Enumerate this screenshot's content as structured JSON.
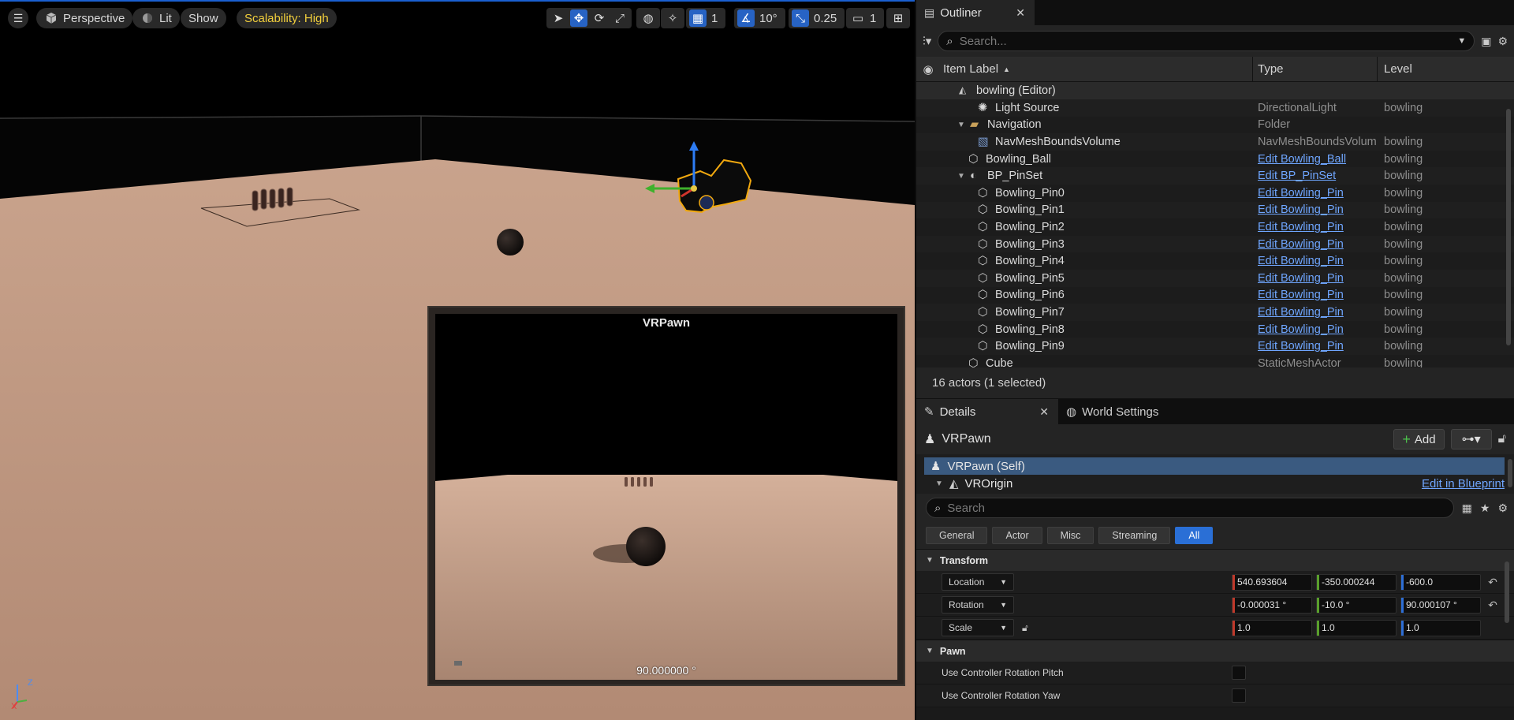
{
  "viewport": {
    "perspective_label": "Perspective",
    "lit_label": "Lit",
    "show_label": "Show",
    "scalability_label": "Scalability: High",
    "grid_value": "1",
    "angle_value": "10°",
    "scale_value": "0.25",
    "camera_value": "1",
    "pip": {
      "title": "VRPawn",
      "angle_readout": "90.000000 °"
    },
    "axis": {
      "x": "X",
      "z": "Z"
    }
  },
  "outliner": {
    "tab_label": "Outliner",
    "search_placeholder": "Search...",
    "columns": {
      "label": "Item Label",
      "type": "Type",
      "level": "Level"
    },
    "top_row": "bowling (Editor)",
    "rows": [
      {
        "label": "Light Source",
        "type": "DirectionalLight",
        "level": "bowling"
      },
      {
        "label": "Navigation",
        "type": "Folder",
        "level": ""
      },
      {
        "label": "NavMeshBoundsVolume",
        "type": "NavMeshBoundsVolum",
        "level": "bowling"
      },
      {
        "label": "Bowling_Ball",
        "type": "Edit Bowling_Ball",
        "level": "bowling"
      },
      {
        "label": "BP_PinSet",
        "type": "Edit BP_PinSet",
        "level": "bowling"
      },
      {
        "label": "Bowling_Pin0",
        "type": "Edit Bowling_Pin",
        "level": "bowling"
      },
      {
        "label": "Bowling_Pin1",
        "type": "Edit Bowling_Pin",
        "level": "bowling"
      },
      {
        "label": "Bowling_Pin2",
        "type": "Edit Bowling_Pin",
        "level": "bowling"
      },
      {
        "label": "Bowling_Pin3",
        "type": "Edit Bowling_Pin",
        "level": "bowling"
      },
      {
        "label": "Bowling_Pin4",
        "type": "Edit Bowling_Pin",
        "level": "bowling"
      },
      {
        "label": "Bowling_Pin5",
        "type": "Edit Bowling_Pin",
        "level": "bowling"
      },
      {
        "label": "Bowling_Pin6",
        "type": "Edit Bowling_Pin",
        "level": "bowling"
      },
      {
        "label": "Bowling_Pin7",
        "type": "Edit Bowling_Pin",
        "level": "bowling"
      },
      {
        "label": "Bowling_Pin8",
        "type": "Edit Bowling_Pin",
        "level": "bowling"
      },
      {
        "label": "Bowling_Pin9",
        "type": "Edit Bowling_Pin",
        "level": "bowling"
      },
      {
        "label": "Cube",
        "type": "StaticMeshActor",
        "level": "bowling"
      }
    ],
    "footer": "16 actors (1 selected)"
  },
  "details": {
    "tab_label": "Details",
    "world_settings_label": "World Settings",
    "actor_name": "VRPawn",
    "add_label": "Add",
    "self_label": "VRPawn (Self)",
    "origin_label": "VROrigin",
    "edit_blueprint_label": "Edit in Blueprint",
    "search_placeholder": "Search",
    "filters": [
      "General",
      "Actor",
      "Misc",
      "Streaming",
      "All"
    ],
    "transform_label": "Transform",
    "location_label": "Location",
    "rotation_label": "Rotation",
    "scale_label": "Scale",
    "location": {
      "x": "540.693604",
      "y": "-350.000244",
      "z": "-600.0"
    },
    "rotation": {
      "x": "-0.000031 °",
      "y": "-10.0 °",
      "z": "90.000107 °"
    },
    "scale": {
      "x": "1.0",
      "y": "1.0",
      "z": "1.0"
    },
    "pawn_label": "Pawn",
    "pitch_label": "Use Controller Rotation Pitch",
    "yaw_label": "Use Controller Rotation Yaw"
  }
}
